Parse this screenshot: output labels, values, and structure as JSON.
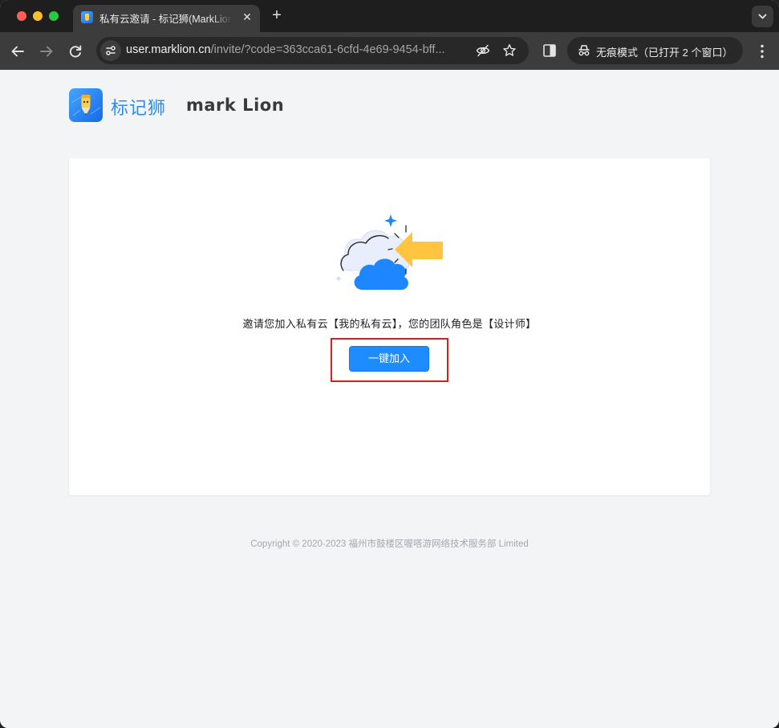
{
  "browser": {
    "tab": {
      "title": "私有云邀请 - 标记狮(MarkLion)",
      "close_glyph": "✕"
    },
    "new_tab_glyph": "+",
    "address_bar": {
      "host": "user.marklion.cn",
      "path": "/invite/?code=363cca61-6cfd-4e69-9454-bff..."
    },
    "incognito_label": "无痕模式（已打开 2 个窗口）"
  },
  "page": {
    "brand": {
      "name_cn": "标记狮",
      "name_en": "mark Lion"
    },
    "invite": {
      "message": "邀请您加入私有云【我的私有云】，您的团队角色是【设计师】",
      "join_button_label": "一键加入"
    },
    "footer": "Copyright © 2020-2023 福州市鼓楼区喔嗒游网络技术服务部 Limited"
  },
  "colors": {
    "accent": "#1e8cff",
    "highlight": "#e21a1a",
    "brand_blue": "#2b8df3",
    "arrow_yellow": "#ffc440"
  }
}
